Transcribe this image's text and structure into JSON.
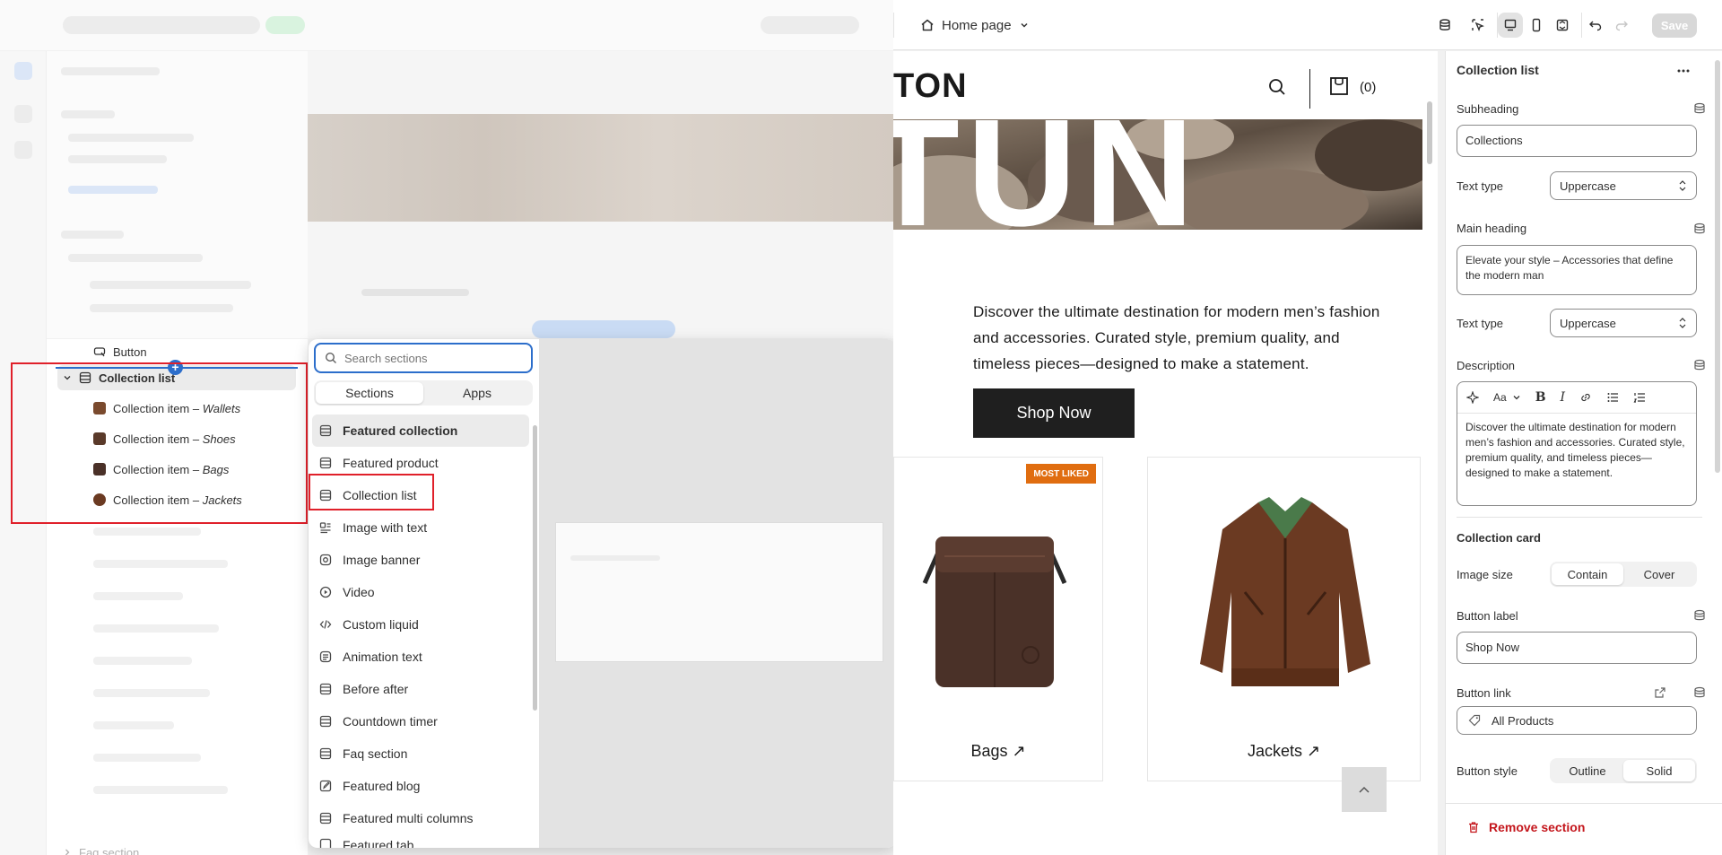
{
  "topbar": {
    "page_label": "Home page",
    "save_label": "Save"
  },
  "layers": {
    "button_label": "Button",
    "collection_list_label": "Collection list",
    "items": [
      {
        "prefix": "Collection item – ",
        "name": "Wallets",
        "color": "#7a4a2e"
      },
      {
        "prefix": "Collection item – ",
        "name": "Shoes",
        "color": "#5a3a2a"
      },
      {
        "prefix": "Collection item – ",
        "name": "Bags",
        "color": "#4a3128"
      },
      {
        "prefix": "Collection item – ",
        "name": "Jackets",
        "color": "#6b3a22"
      }
    ],
    "faq_label": "Faq section"
  },
  "popup": {
    "search_placeholder": "Search sections",
    "tabs": [
      "Sections",
      "Apps"
    ],
    "sections": [
      {
        "label": "Featured collection",
        "icon": "section-icon"
      },
      {
        "label": "Featured product",
        "icon": "section-icon"
      },
      {
        "label": "Collection list",
        "icon": "section-icon"
      },
      {
        "label": "Image with text",
        "icon": "image-text-icon"
      },
      {
        "label": "Image banner",
        "icon": "image-icon"
      },
      {
        "label": "Video",
        "icon": "play-icon"
      },
      {
        "label": "Custom liquid",
        "icon": "code-icon"
      },
      {
        "label": "Animation text",
        "icon": "text-icon"
      },
      {
        "label": "Before after",
        "icon": "section-icon"
      },
      {
        "label": "Countdown timer",
        "icon": "section-icon"
      },
      {
        "label": "Faq section",
        "icon": "section-icon"
      },
      {
        "label": "Featured blog",
        "icon": "blog-icon"
      },
      {
        "label": "Featured multi columns",
        "icon": "section-icon"
      },
      {
        "label": "Featured tab",
        "icon": "section-icon"
      }
    ]
  },
  "preview": {
    "logo_text": "TON",
    "hero_text": "TUN",
    "cart_count": "(0)",
    "description": "Discover the ultimate destination for modern men’s fashion and accessories. Curated style, premium quality, and timeless pieces—designed to make a statement.",
    "shop_now": "Shop Now",
    "badge": "MOST LIKED",
    "cards": [
      {
        "label": "Bags ↗"
      },
      {
        "label": "Jackets ↗"
      }
    ]
  },
  "settings": {
    "title": "Collection list",
    "subheading_label": "Subheading",
    "subheading_value": "Collections",
    "text_type_label": "Text type",
    "text_type_value": "Uppercase",
    "main_heading_label": "Main heading",
    "main_heading_value": "Elevate your style – Accessories that define the modern man",
    "text_type2_label": "Text type",
    "text_type2_value": "Uppercase",
    "description_label": "Description",
    "description_value": "Discover the ultimate destination for modern men’s fashion and accessories. Curated style, premium quality, and timeless pieces—designed to make a statement.",
    "collection_card_title": "Collection card",
    "image_size_label": "Image size",
    "image_size_options": [
      "Contain",
      "Cover"
    ],
    "button_label_label": "Button label",
    "button_label_value": "Shop Now",
    "button_link_label": "Button link",
    "button_link_value": "All Products",
    "button_style_label": "Button style",
    "button_style_options": [
      "Outline",
      "Solid"
    ],
    "remove_label": "Remove section",
    "rte_font_label": "Aa"
  },
  "colors": {
    "accent": "#2c6ecb",
    "highlight_box": "#e0202a",
    "badge": "#e06d10",
    "danger": "#c4161c"
  }
}
